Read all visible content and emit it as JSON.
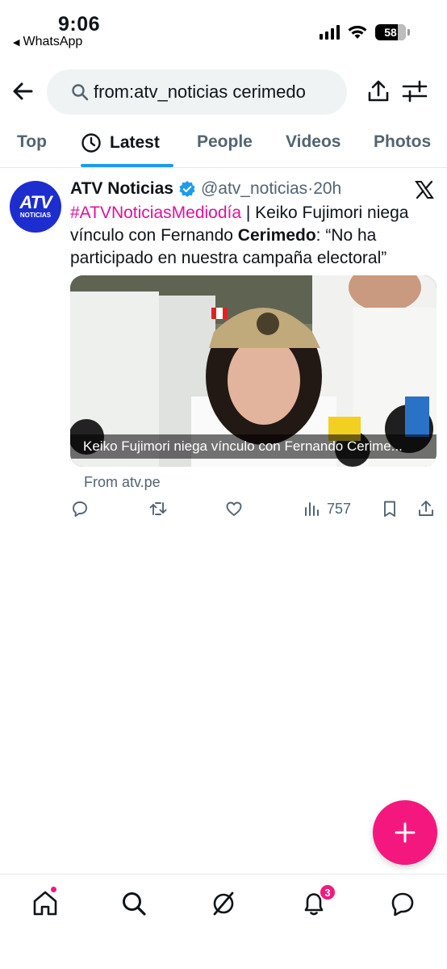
{
  "status_bar": {
    "time": "9:06",
    "back_app": "WhatsApp",
    "battery": "58"
  },
  "search": {
    "query": "from:atv_noticias cerimedo"
  },
  "tabs": [
    {
      "label": "Top",
      "active": false
    },
    {
      "label": "Latest",
      "active": true
    },
    {
      "label": "People",
      "active": false
    },
    {
      "label": "Videos",
      "active": false
    },
    {
      "label": "Photos",
      "active": false
    }
  ],
  "tweet": {
    "avatar": {
      "logo": "ATV",
      "sub": "NOTICIAS"
    },
    "name": "ATV Noticias",
    "handle": "@atv_noticias",
    "separator": "·",
    "time": "20h",
    "text": {
      "hashtag": "#ATVNoticiasMediodía",
      "part1": " | Keiko Fujimori niega vínculo con Fernando ",
      "bold": "Cerimedo",
      "part2": ": “No ha participado en nuestra campaña electoral”"
    },
    "media_caption": "Keiko Fujimori niega vínculo con Fernando Cerime...",
    "media_source": "From atv.pe",
    "views": "757"
  },
  "bottom_nav": {
    "notification_count": "3"
  },
  "colors": {
    "accent": "#1d9bf0",
    "hashtag": "#e0119c",
    "fab": "#f4187e",
    "avatar_bg": "#1d2dce"
  },
  "icons": [
    "back-arrow-icon",
    "search-icon",
    "share-icon",
    "filter-icon",
    "clock-icon",
    "verified-icon",
    "x-logo-icon",
    "reply-icon",
    "retweet-icon",
    "like-icon",
    "views-icon",
    "bookmark-icon",
    "plus-icon",
    "home-icon",
    "grok-icon",
    "bell-icon",
    "messages-icon"
  ]
}
